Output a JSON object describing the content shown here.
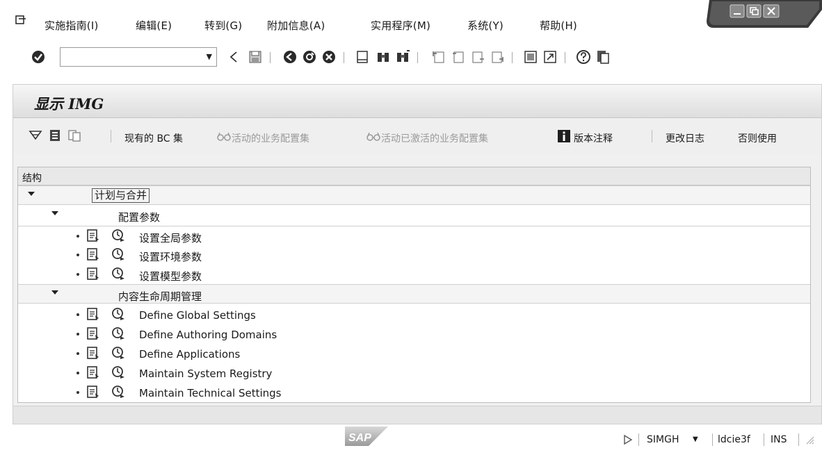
{
  "menu": {
    "items": [
      "实施指南(I)",
      "编辑(E)",
      "转到(G)",
      "附加信息(A)",
      "实用程序(M)",
      "系统(Y)",
      "帮助(H)"
    ]
  },
  "window_controls": [
    "minimize-icon",
    "restore-icon",
    "close-icon"
  ],
  "toolbar": {
    "command_field_value": "",
    "icons": [
      "enter-icon",
      "back-icon",
      "save-icon",
      "green-back-icon",
      "exit-icon",
      "cancel-icon",
      "print-icon",
      "find-icon",
      "find-next-icon",
      "first-page-icon",
      "previous-page-icon",
      "next-page-icon",
      "last-page-icon",
      "create-session-icon",
      "shortcut-icon",
      "help-icon",
      "layout-menu-icon"
    ]
  },
  "page": {
    "title": "显示 IMG"
  },
  "app_toolbar": {
    "items": [
      {
        "label": "现有的 BC 集",
        "enabled": true
      },
      {
        "label": "活动的业务配置集",
        "enabled": false
      },
      {
        "label": "活动已激活的业务配置集",
        "enabled": false
      },
      {
        "label": "版本注释",
        "enabled": true
      },
      {
        "label": "更改日志",
        "enabled": true
      },
      {
        "label": "否则使用",
        "enabled": true
      }
    ]
  },
  "tree": {
    "header": "结构",
    "nodes": [
      {
        "level": 1,
        "type": "folder",
        "label": "计划与合并",
        "expanded": true,
        "selected": true
      },
      {
        "level": 2,
        "type": "folder",
        "label": "配置参数",
        "expanded": true
      },
      {
        "level": 3,
        "type": "activity",
        "label": "设置全局参数"
      },
      {
        "level": 3,
        "type": "activity",
        "label": "设置环境参数"
      },
      {
        "level": 3,
        "type": "activity",
        "label": "设置模型参数"
      },
      {
        "level": 2,
        "type": "folder",
        "label": "内容生命周期管理",
        "expanded": true
      },
      {
        "level": 3,
        "type": "activity",
        "label": "Define Global Settings"
      },
      {
        "level": 3,
        "type": "activity",
        "label": "Define Authoring Domains"
      },
      {
        "level": 3,
        "type": "activity",
        "label": "Define Applications"
      },
      {
        "level": 3,
        "type": "activity",
        "label": "Maintain System Registry"
      },
      {
        "level": 3,
        "type": "activity",
        "label": "Maintain Technical Settings"
      }
    ]
  },
  "status_bar": {
    "logo": "SAP",
    "system": "SIMGH",
    "server": "ldcie3f",
    "mode": "INS"
  }
}
